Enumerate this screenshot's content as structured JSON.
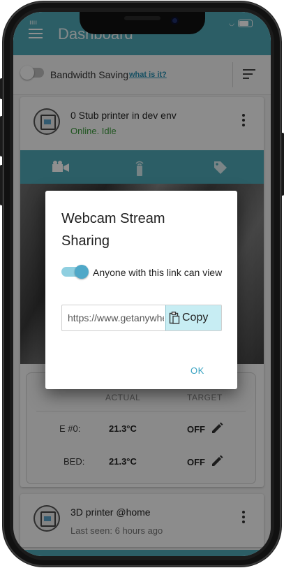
{
  "app": {
    "title": "Dashboard"
  },
  "status_bar": {
    "carrier": "ıııı",
    "right": "∘"
  },
  "bandwidth": {
    "label": "Bandwidth Saving",
    "link": "what is it?",
    "enabled": false
  },
  "printers": [
    {
      "name": "0 Stub printer in dev env",
      "status": "Online. Idle"
    },
    {
      "name": "3D printer @home",
      "status": "Last seen: 6 hours ago"
    }
  ],
  "tabs": [
    {
      "icon": "webcam-icon"
    },
    {
      "icon": "remote-icon"
    },
    {
      "icon": "tag-icon"
    }
  ],
  "temperatures": {
    "headers": {
      "actual": "ACTUAL",
      "target": "TARGET"
    },
    "rows": [
      {
        "label": "E #0:",
        "actual": "21.3°C",
        "target": "OFF"
      },
      {
        "label": "BED:",
        "actual": "21.3°C",
        "target": "OFF"
      }
    ]
  },
  "dialog": {
    "title": "Webcam Stream Sharing",
    "toggle_label": "Anyone with this link can view",
    "toggle_on": true,
    "link_value": "https://www.getanywhere.io",
    "copy_label": "Copy",
    "ok_label": "OK"
  },
  "colors": {
    "accent": "#4fa8b6",
    "online": "#3d9a3d",
    "link": "#2a8fb0"
  }
}
